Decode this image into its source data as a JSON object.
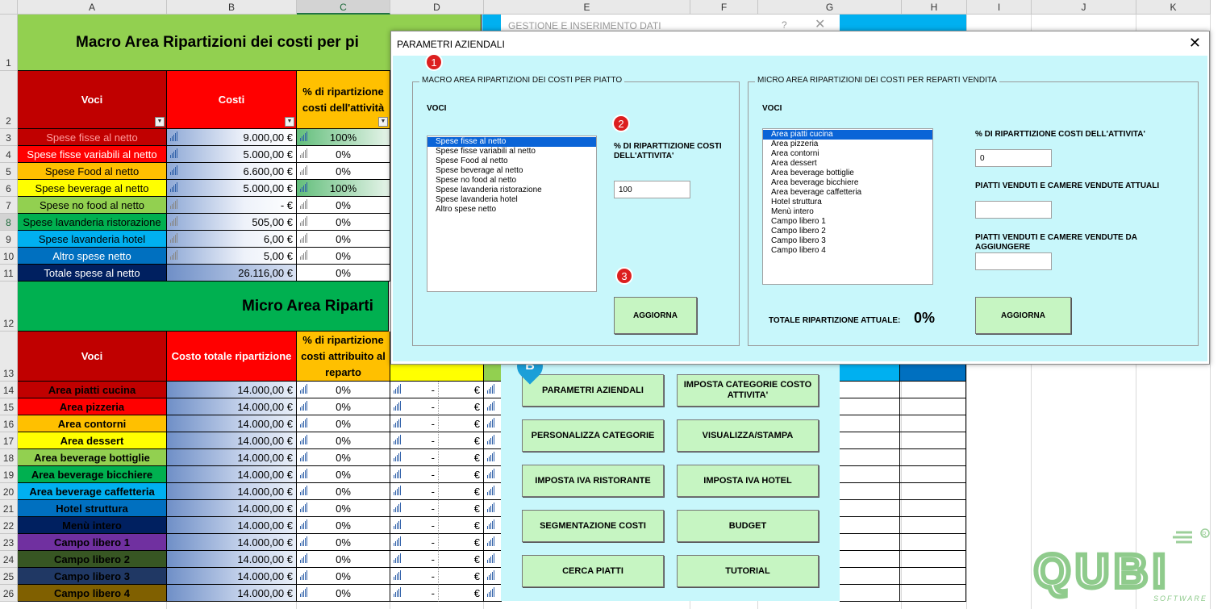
{
  "columns": [
    "A",
    "B",
    "C",
    "D",
    "E",
    "F",
    "G",
    "H",
    "I",
    "J",
    "K"
  ],
  "rows": [
    "1",
    "2",
    "3",
    "4",
    "5",
    "6",
    "7",
    "8",
    "9",
    "10",
    "11",
    "12",
    "13",
    "14",
    "15",
    "16",
    "17",
    "18",
    "19",
    "20",
    "21",
    "22",
    "23",
    "24",
    "25",
    "26"
  ],
  "sheet": {
    "macro_title": "Macro Area Ripartizioni dei costi per pi",
    "micro_title": "Micro Area Riparti",
    "macro_headers": {
      "voci": "Voci",
      "costi": "Costi",
      "perc": "% di ripartizione costi dell'attività"
    },
    "macro_rows": [
      {
        "voce": "Spese fisse al netto",
        "costo": "9.000,00 €",
        "perc": "100%",
        "color": "#c00000",
        "text": "#ff9a9a"
      },
      {
        "voce": "Spese fisse variabili al netto",
        "costo": "5.000,00 €",
        "perc": "0%",
        "color": "#ff0000",
        "text": "#ffffff"
      },
      {
        "voce": "Spese Food al netto",
        "costo": "6.600,00 €",
        "perc": "0%",
        "color": "#ffc000",
        "text": "#000000"
      },
      {
        "voce": "Spese beverage al netto",
        "costo": "5.000,00 €",
        "perc": "100%",
        "color": "#ffff00",
        "text": "#000000"
      },
      {
        "voce": "Spese no food al netto",
        "costo": "-      €",
        "perc": "0%",
        "color": "#92d050",
        "text": "#000000"
      },
      {
        "voce": "Spese lavanderia ristorazione",
        "costo": "505,00 €",
        "perc": "0%",
        "color": "#00b050",
        "text": "#000000"
      },
      {
        "voce": "Spese lavanderia hotel",
        "costo": "6,00 €",
        "perc": "0%",
        "color": "#00b0f0",
        "text": "#000000"
      },
      {
        "voce": "Altro spese netto",
        "costo": "5,00 €",
        "perc": "0%",
        "color": "#0070c0",
        "text": "#ffffff"
      },
      {
        "voce": "Totale spese al netto",
        "costo": "26.116,00 €",
        "perc": "0%",
        "color": "#002060",
        "text": "#ffffff"
      }
    ],
    "micro_headers": {
      "voci": "Voci",
      "costo": "Costo totale ripartizione",
      "perc": "% di ripartizione costi attribuito al reparto"
    },
    "micro_rows": [
      {
        "voce": "Area piatti cucina",
        "costo": "14.000,00 €",
        "perc": "0%",
        "color": "#c00000"
      },
      {
        "voce": "Area pizzeria",
        "costo": "14.000,00 €",
        "perc": "0%",
        "color": "#ff0000"
      },
      {
        "voce": "Area contorni",
        "costo": "14.000,00 €",
        "perc": "0%",
        "color": "#ffc000"
      },
      {
        "voce": "Area dessert",
        "costo": "14.000,00 €",
        "perc": "0%",
        "color": "#ffff00"
      },
      {
        "voce": "Area beverage bottiglie",
        "costo": "14.000,00 €",
        "perc": "0%",
        "color": "#92d050"
      },
      {
        "voce": "Area beverage bicchiere",
        "costo": "14.000,00 €",
        "perc": "0%",
        "color": "#00b050"
      },
      {
        "voce": "Area beverage caffetteria",
        "costo": "14.000,00 €",
        "perc": "0%",
        "color": "#00b0f0"
      },
      {
        "voce": "Hotel struttura",
        "costo": "14.000,00 €",
        "perc": "0%",
        "color": "#0070c0"
      },
      {
        "voce": "Menù intero",
        "costo": "14.000,00 €",
        "perc": "0%",
        "color": "#002060"
      },
      {
        "voce": "Campo libero 1",
        "costo": "14.000,00 €",
        "perc": "0%",
        "color": "#7030a0"
      },
      {
        "voce": "Campo libero 2",
        "costo": "14.000,00 €",
        "perc": "0%",
        "color": "#375623"
      },
      {
        "voce": "Campo libero 3",
        "costo": "14.000,00 €",
        "perc": "0%",
        "color": "#203864"
      },
      {
        "voce": "Campo libero 4",
        "costo": "14.000,00 €",
        "perc": "0%",
        "color": "#806000"
      }
    ],
    "d_value": "-",
    "euro": "€"
  },
  "gestione": {
    "title": "GESTIONE E INSERIMENTO DATI",
    "help": "?",
    "buttons": [
      "PARAMETRI AZIENDALI",
      "IMPOSTA CATEGORIE COSTO ATTIVITA'",
      "PERSONALIZZA CATEGORIE",
      "VISUALIZZA/STAMPA",
      "IMPOSTA IVA RISTORANTE",
      "IMPOSTA IVA HOTEL",
      "SEGMENTAZIONE COSTI",
      "BUDGET",
      "CERCA PIATTI",
      "TUTORIAL"
    ]
  },
  "param": {
    "title": "PARAMETRI AZIENDALI",
    "macro": {
      "legend": "MACRO AREA RIPARTIZIONI DEI COSTI PER PIATTO",
      "voci_label": "VOCI",
      "items": [
        "Spese fisse al netto",
        "Spese fisse variabili al netto",
        "Spese Food al netto",
        "Spese beverage al netto",
        "Spese no food al netto",
        "Spese lavanderia ristorazione",
        "Spese lavanderia hotel",
        "Altro spese netto"
      ],
      "perc_label": "% DI RIPARTTIZIONE COSTI DELL'ATTIVITA'",
      "perc_value": "100",
      "update_label": "AGGIORNA"
    },
    "micro": {
      "legend": "MICRO AREA RIPARTIZIONI DEI COSTI PER REPARTI VENDITA",
      "voci_label": "VOCI",
      "items": [
        "Area piatti cucina",
        "Area pizzeria",
        "Area contorni",
        "Area dessert",
        "Area beverage bottiglie",
        "Area beverage bicchiere",
        "Area beverage caffetteria",
        "Hotel struttura",
        "Menù intero",
        "Campo libero 1",
        "Campo libero 2",
        "Campo libero 3",
        "Campo libero 4"
      ],
      "perc_label": "% DI RIPARTTIZIONE COSTI DELL'ATTIVITA'",
      "perc_value": "0",
      "sold_label": "PIATTI VENDUTI E CAMERE VENDUTE ATTUALI",
      "sold_value": "",
      "add_label": "PIATTI VENDUTI E CAMERE VENDUTE DA AGGIUNGERE",
      "add_value": "",
      "total_label": "TOTALE RIPARTIZIONE ATTUALE:",
      "total_value": "0%",
      "update_label": "AGGIORNA"
    }
  },
  "badges": [
    "1",
    "2",
    "3"
  ],
  "pin": "B",
  "logo": {
    "text": "QUBI",
    "sub": "SOFTWARE"
  }
}
